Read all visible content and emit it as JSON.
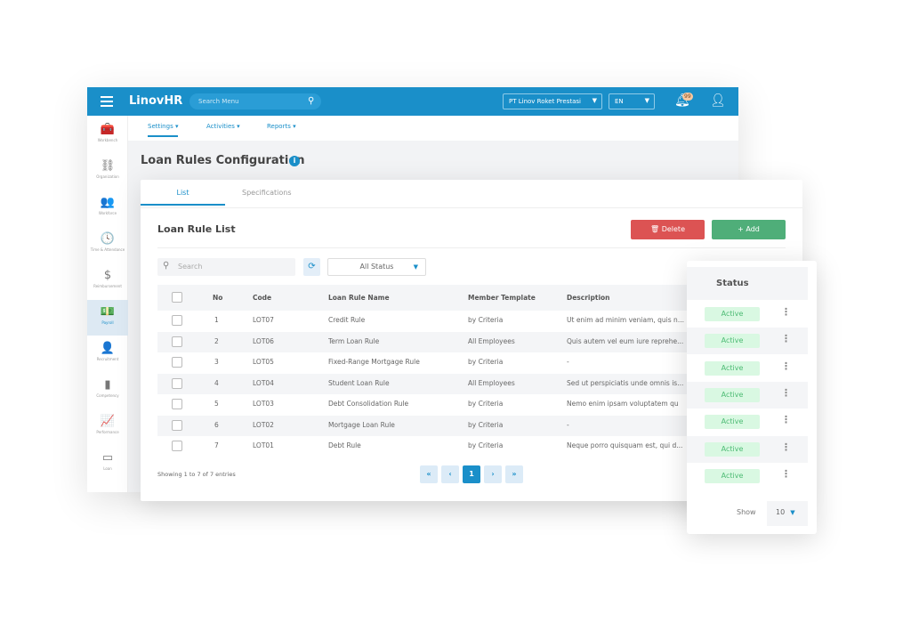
{
  "app": {
    "logo": "LinovHR",
    "search_placeholder": "Search Menu",
    "company": "PT Linov Roket Prestasi",
    "language": "EN",
    "notifications": "99"
  },
  "nav": [
    {
      "label": "Settings"
    },
    {
      "label": "Activities"
    },
    {
      "label": "Reports"
    }
  ],
  "sidebar": [
    {
      "label": "Workbench",
      "icon": "toolbox-icon",
      "glyph": "🧰"
    },
    {
      "label": "Organization",
      "icon": "org-chart-icon",
      "glyph": "⛓"
    },
    {
      "label": "Workforce",
      "icon": "users-icon",
      "glyph": "👥"
    },
    {
      "label": "Time & Attendance",
      "icon": "clock-icon",
      "glyph": "🕓"
    },
    {
      "label": "Reimbursement",
      "icon": "hand-dollar-icon",
      "glyph": "$"
    },
    {
      "label": "Payroll",
      "icon": "money-icon",
      "glyph": "💵"
    },
    {
      "label": "Recruitment",
      "icon": "user-plus-icon",
      "glyph": "👤"
    },
    {
      "label": "Competency",
      "icon": "bar-chart-icon",
      "glyph": "▮"
    },
    {
      "label": "Performance",
      "icon": "line-chart-icon",
      "glyph": "📈"
    },
    {
      "label": "Loan",
      "icon": "card-icon",
      "glyph": "▭"
    }
  ],
  "page": {
    "title": "Loan Rules Configuration"
  },
  "tabs": [
    {
      "label": "List"
    },
    {
      "label": "Specifications"
    }
  ],
  "list": {
    "title": "Loan Rule List",
    "delete": "Delete",
    "add": "Add",
    "search_placeholder": "Search",
    "status_filter": "All Status",
    "columns": [
      "No",
      "Code",
      "Loan Rule Name",
      "Member Template",
      "Description",
      "Status"
    ],
    "rows": [
      {
        "no": "1",
        "code": "LOT07",
        "name": "Credit Rule",
        "template": "by Criteria",
        "desc": "Ut enim ad minim veniam, quis n...",
        "status": "Active"
      },
      {
        "no": "2",
        "code": "LOT06",
        "name": "Term Loan Rule",
        "template": "All Employees",
        "desc": "Quis autem vel eum iure reprehe...",
        "status": "Active"
      },
      {
        "no": "3",
        "code": "LOT05",
        "name": "Fixed-Range Mortgage Rule",
        "template": "by Criteria",
        "desc": "-",
        "status": "Active"
      },
      {
        "no": "4",
        "code": "LOT04",
        "name": "Student Loan Rule",
        "template": "All Employees",
        "desc": "Sed ut perspiciatis unde omnis is...",
        "status": "Active"
      },
      {
        "no": "5",
        "code": "LOT03",
        "name": "Debt Consolidation Rule",
        "template": "by Criteria",
        "desc": "Nemo enim ipsam voluptatem qu",
        "status": "Active"
      },
      {
        "no": "6",
        "code": "LOT02",
        "name": "Mortgage Loan Rule",
        "template": "by Criteria",
        "desc": "-",
        "status": "Active"
      },
      {
        "no": "7",
        "code": "LOT01",
        "name": "Debt Rule",
        "template": "by Criteria",
        "desc": "Neque porro quisquam est, qui d...",
        "status": "Active"
      }
    ],
    "showing": "Showing 1 to 7 of 7 entries",
    "page": "1",
    "show_label": "Show",
    "page_size": "10"
  },
  "colors": {
    "primary": "#1a8fc9",
    "delete": "#dc5353",
    "add": "#4fae79",
    "active_bg": "#d9f8e2",
    "active_text": "#4dbb74"
  }
}
